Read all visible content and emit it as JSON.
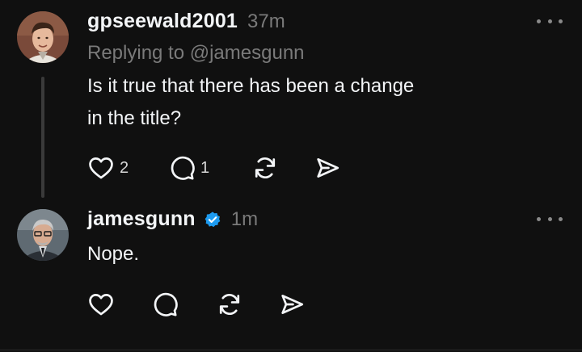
{
  "posts": [
    {
      "username": "gpseewald2001",
      "time": "37m",
      "replying_to": "Replying to @jamesgunn",
      "text_line1": "Is it true that there has been a change",
      "text_line2": "in the title?",
      "like_count": "2",
      "reply_count": "1",
      "verified": false
    },
    {
      "username": "jamesgunn",
      "time": "1m",
      "text_line1": "Nope.",
      "verified": true
    }
  ],
  "icons": {
    "like": "heart-icon",
    "reply": "comment-icon",
    "repost": "repost-icon",
    "share": "send-icon",
    "more": "more-icon",
    "verified": "verified-badge-icon"
  },
  "colors": {
    "background": "#101010",
    "text": "#f3f5f7",
    "muted": "#7a7a7a",
    "verified": "#1d9bf0"
  }
}
